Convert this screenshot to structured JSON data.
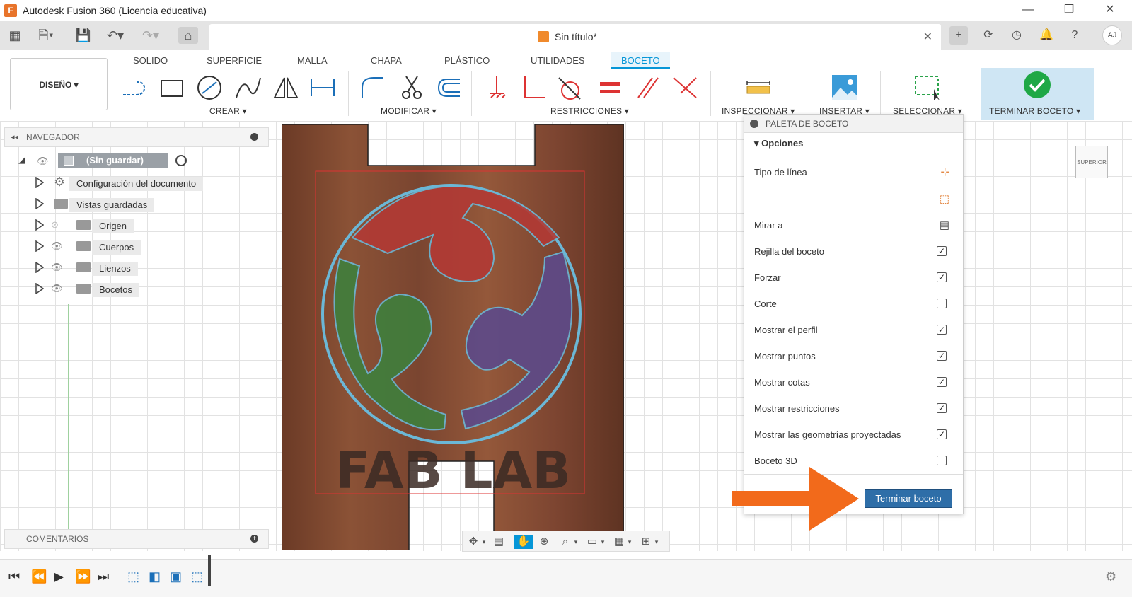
{
  "window": {
    "title": "Autodesk Fusion 360 (Licencia educativa)",
    "minimize": "—",
    "maximize": "❐",
    "close": "✕"
  },
  "document": {
    "title": "Sin título*",
    "close": "✕"
  },
  "user": {
    "initials": "AJ"
  },
  "ribbon": {
    "tabs": [
      "SOLIDO",
      "SUPERFICIE",
      "MALLA",
      "CHAPA",
      "PLÁSTICO",
      "UTILIDADES",
      "BOCETO"
    ],
    "active_tab": "BOCETO",
    "design_button": "DISEÑO ▾",
    "groups": {
      "crear": "CREAR ▾",
      "modificar": "MODIFICAR ▾",
      "restricciones": "RESTRICCIONES ▾",
      "inspeccionar": "INSPECCIONAR ▾",
      "insertar": "INSERTAR ▾",
      "seleccionar": "SELECCIONAR ▾",
      "terminar": "TERMINAR BOCETO ▾"
    }
  },
  "navigator": {
    "title": "NAVEGADOR",
    "root": "(Sin guardar)",
    "items": [
      {
        "label": "Configuración del documento",
        "icon": "gear-icon"
      },
      {
        "label": "Vistas guardadas",
        "icon": "folder-icon"
      },
      {
        "label": "Origen",
        "icon": "folder-icon"
      },
      {
        "label": "Cuerpos",
        "icon": "folder-icon"
      },
      {
        "label": "Lienzos",
        "icon": "folder-icon"
      },
      {
        "label": "Bocetos",
        "icon": "folder-icon"
      }
    ]
  },
  "comments": {
    "title": "COMENTARIOS"
  },
  "canvas": {
    "logo_text": "FAB LAB"
  },
  "viewcube": {
    "label": "SUPERIOR"
  },
  "palette": {
    "title": "PALETA DE BOCETO",
    "section": "Opciones",
    "rows": [
      {
        "label": "Tipo de línea",
        "control": "icon",
        "icon": "construction-line-icon"
      },
      {
        "label": "",
        "control": "icon",
        "icon": "centerline-icon"
      },
      {
        "label": "Mirar a",
        "control": "icon",
        "icon": "look-at-icon"
      },
      {
        "label": "Rejilla del boceto",
        "control": "checkbox",
        "checked": true
      },
      {
        "label": "Forzar",
        "control": "checkbox",
        "checked": true
      },
      {
        "label": "Corte",
        "control": "checkbox",
        "checked": false
      },
      {
        "label": "Mostrar el perfil",
        "control": "checkbox",
        "checked": true
      },
      {
        "label": "Mostrar puntos",
        "control": "checkbox",
        "checked": true
      },
      {
        "label": "Mostrar cotas",
        "control": "checkbox",
        "checked": true
      },
      {
        "label": "Mostrar restricciones",
        "control": "checkbox",
        "checked": true
      },
      {
        "label": "Mostrar las geometrías proyectadas",
        "control": "checkbox",
        "checked": true
      },
      {
        "label": "Boceto 3D",
        "control": "checkbox",
        "checked": false
      }
    ],
    "finish_button": "Terminar boceto"
  },
  "colors": {
    "accent": "#0696d7",
    "finish_button": "#2e6ea8",
    "arrow": "#f26a1b"
  }
}
